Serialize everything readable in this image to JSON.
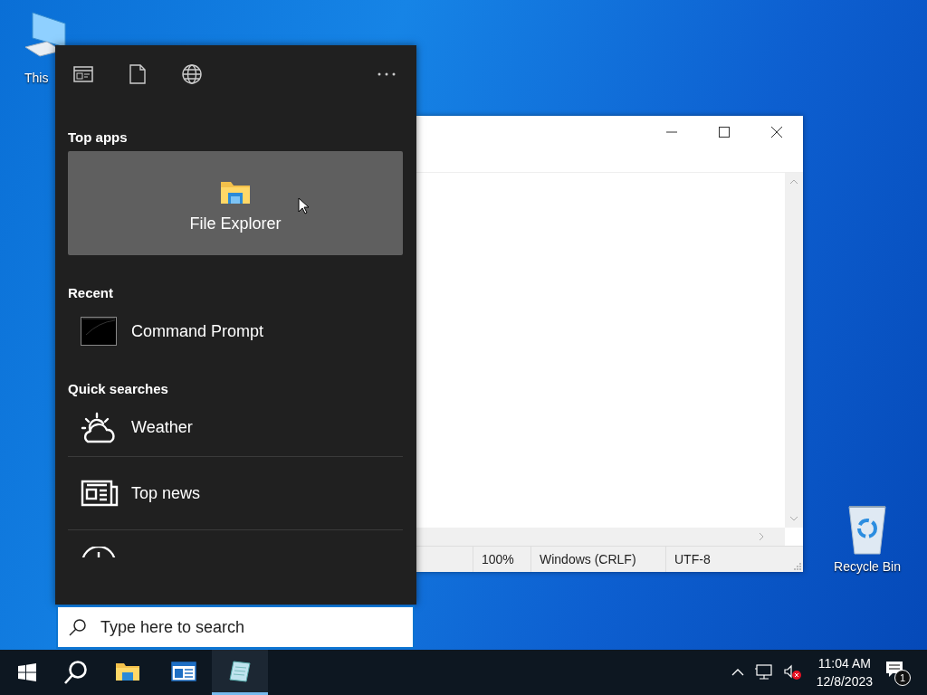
{
  "desktop_icons": [
    {
      "label": "This"
    },
    {
      "label": "Recycle Bin"
    }
  ],
  "notepad": {
    "status_bar": [
      "100%",
      "Windows (CRLF)",
      "UTF-8"
    ]
  },
  "search_panel": {
    "sections": [
      {
        "title": "Top apps",
        "kind": "tile",
        "items": [
          {
            "label": "File Explorer"
          }
        ]
      },
      {
        "title": "Recent",
        "kind": "list",
        "items": [
          {
            "label": "Command Prompt"
          }
        ]
      },
      {
        "title": "Quick searches",
        "kind": "list",
        "items": [
          {
            "label": "Weather"
          },
          {
            "label": "Top news"
          }
        ]
      }
    ],
    "search_field": {
      "placeholder": "Type here to search"
    }
  },
  "taskbar": {
    "apps": [
      {
        "selected": false
      },
      {
        "selected": false
      },
      {
        "selected": true
      }
    ],
    "clock": {
      "time": "11:04 AM",
      "date": "12/8/2023"
    },
    "notification_count": "1"
  }
}
